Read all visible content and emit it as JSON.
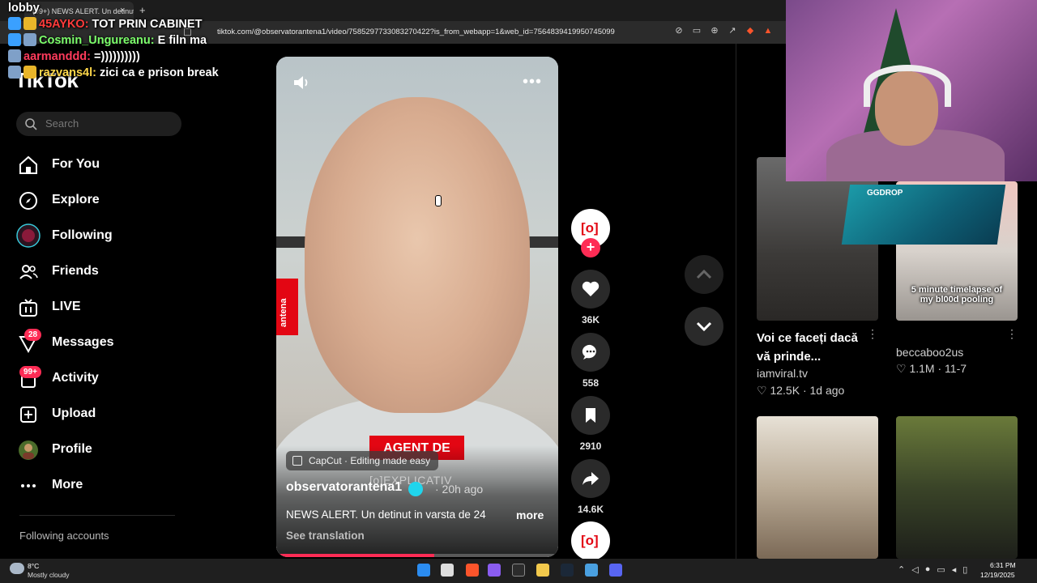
{
  "browser": {
    "tab_title": "(99+) NEWS ALERT. Un detinut",
    "tab_close": "×",
    "new_tab": "+",
    "url": "tiktok.com/@observatorantena1/video/7585297733083270422?is_from_webapp=1&web_id=7564839419950745099"
  },
  "chat_overlay": [
    {
      "user": "lobby",
      "message": "",
      "color": "#ffffff"
    },
    {
      "user": "45AYKO:",
      "message": " TOT PRIN CABINET",
      "color": "#ff3b3b"
    },
    {
      "user": "Cosmin_Ungureanu:",
      "message": " E filn ma",
      "color": "#7cff6b"
    },
    {
      "user": "aarmanddd:",
      "message": " =))))))))))",
      "color": "#ff3b5c"
    },
    {
      "user": "razvans4l:",
      "message": " zici ca e prison break",
      "color": "#ffd84a"
    }
  ],
  "sidebar": {
    "logo": "TikTok",
    "search_placeholder": "Search",
    "items": [
      {
        "label": "For You",
        "icon": "home-icon"
      },
      {
        "label": "Explore",
        "icon": "compass-icon"
      },
      {
        "label": "Following",
        "icon": "following-avatar-icon"
      },
      {
        "label": "Friends",
        "icon": "friends-icon"
      },
      {
        "label": "LIVE",
        "icon": "live-tv-icon"
      },
      {
        "label": "Messages",
        "icon": "messages-icon",
        "badge": "28"
      },
      {
        "label": "Activity",
        "icon": "activity-icon",
        "badge": "99+"
      },
      {
        "label": "Upload",
        "icon": "upload-icon"
      },
      {
        "label": "Profile",
        "icon": "profile-avatar-icon"
      },
      {
        "label": "More",
        "icon": "more-dots-icon"
      }
    ],
    "following_accounts_label": "Following accounts"
  },
  "video": {
    "brand_tag": "antena",
    "overlay_headline": "AGENT DE",
    "overlay_sub": "[o]EXPLICATIV",
    "capcut_label": "CapCut · Editing made easy",
    "author": "observatorantena1",
    "time_ago": "· 20h ago",
    "caption": "NEWS ALERT. Un detinut in varsta de 24",
    "more_label": "more",
    "see_translation": "See translation",
    "progress_fraction": 0.56,
    "more_menu": "•••"
  },
  "actions": {
    "avatar_text": "[o]",
    "follow_plus": "+",
    "likes": "36K",
    "comments": "558",
    "saves": "2910",
    "shares": "14.6K"
  },
  "recommended": [
    {
      "title": "Voi ce faceți dacă vă prinde...",
      "user": "iamviral.tv",
      "likes": "12.5K",
      "date": "1d ago"
    },
    {
      "title": "",
      "user": "beccaboo2us",
      "likes": "1.1M",
      "date": "11-7",
      "overlay_text": "5 minute timelapse of my bl00d pooling"
    },
    {
      "title": "",
      "user": "",
      "likes": "",
      "date": ""
    },
    {
      "title": "",
      "user": "",
      "likes": "",
      "date": ""
    }
  ],
  "sponsor": {
    "label": "GGDROP"
  },
  "taskbar": {
    "temp": "8°C",
    "condition": "Mostly cloudy",
    "time": "6:31 PM",
    "date": "12/19/2025"
  },
  "colors": {
    "accent": "#fe2c55",
    "brand_red": "#e30613",
    "verified": "#20d5ec"
  }
}
